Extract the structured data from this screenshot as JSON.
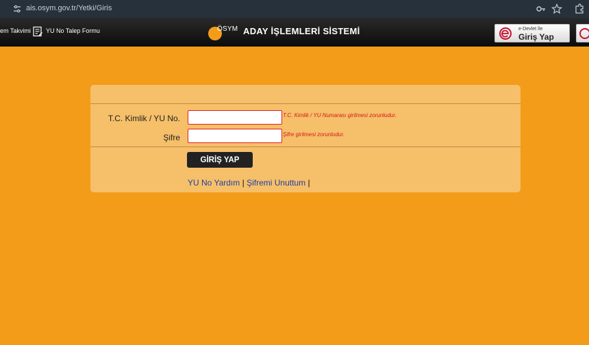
{
  "browser": {
    "url": "ais.osym.gov.tr/Yetki/Giris",
    "icons": [
      "site-settings-icon",
      "password-key-icon",
      "bookmark-star-icon",
      "extensions-icon"
    ]
  },
  "header": {
    "nav_items": [
      "em Takvimi",
      "YU No Talep Formu"
    ],
    "nav_icon": "form-icon",
    "logo_text": "ÖSYM",
    "title": "ADAY İŞLEMLERİ SİSTEMİ",
    "edevlet": {
      "small": "e-Devlet İle",
      "big": "Giriş Yap"
    }
  },
  "form": {
    "id_label": "T.C. Kimlik / YU No.",
    "id_value": "",
    "id_error": "T.C. Kimlik / YU Numarası girilmesi zorunludur.",
    "password_label": "Şifre",
    "password_value": "",
    "password_error": "Şifre girilmesi zorunludur.",
    "submit_label": "GİRİŞ YAP",
    "links": [
      "YU No Yardım",
      "Şifremi Unuttum"
    ],
    "separator": "|"
  },
  "colors": {
    "background": "#f39c1a",
    "panel": "#f6bf69",
    "error": "#d21a1a",
    "link": "#1f3fa6",
    "header": "#111111",
    "logo_accent": "#f39c1a",
    "edevlet_red": "#c8102e"
  }
}
